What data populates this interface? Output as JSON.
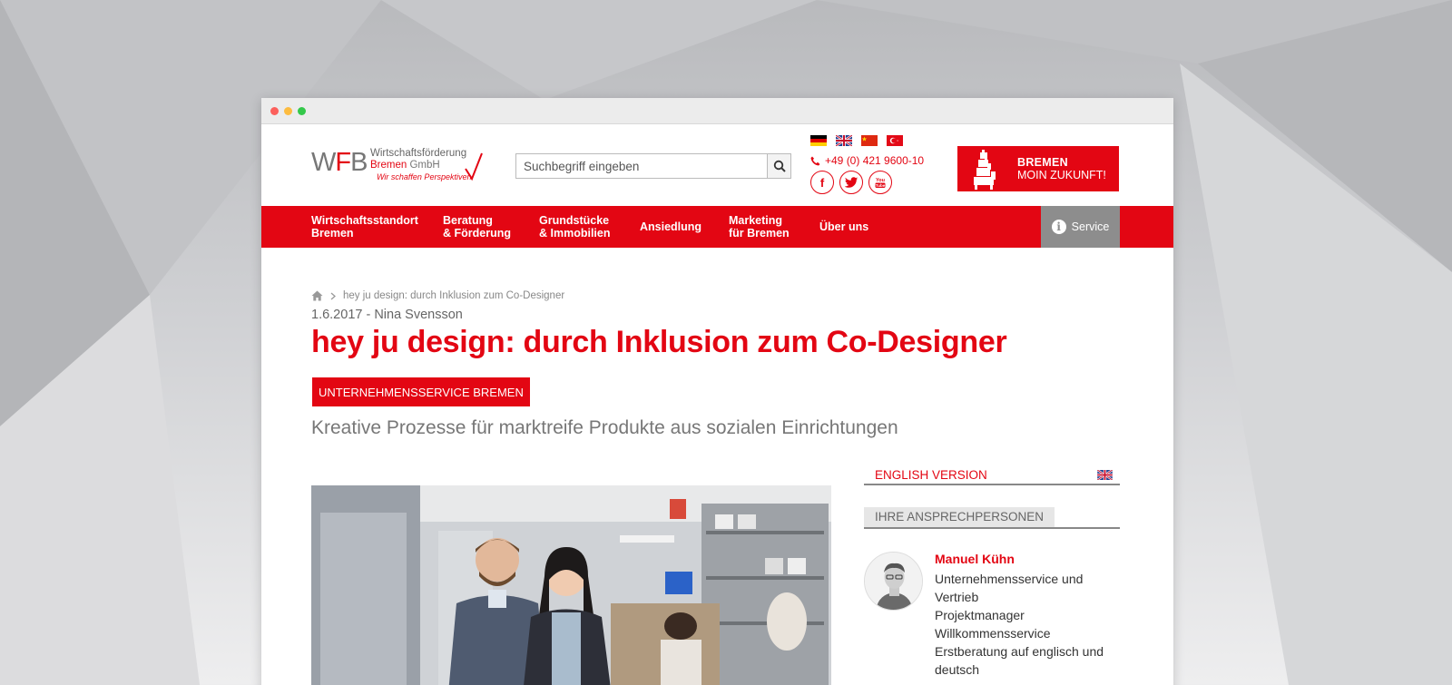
{
  "logo": {
    "wfb_w": "W",
    "wfb_f": "F",
    "wfb_b": "B",
    "line1": "Wirtschaftsförderung",
    "line2_red": "Bremen",
    "line2_grey": "GmbH",
    "tagline": "Wir schaffen Perspektiven"
  },
  "search": {
    "placeholder": "Suchbegriff eingeben",
    "icon": "search-icon"
  },
  "languages": [
    "de",
    "en",
    "zh",
    "tr"
  ],
  "contact": {
    "phone": "+49 (0) 421 9600-10"
  },
  "social": {
    "facebook": "f",
    "youtube": "You Tube"
  },
  "brand": {
    "line1": "BREMEN",
    "line2": "MOIN ZUKUNFT!"
  },
  "nav": {
    "items": [
      {
        "line1": "Wirtschaftsstandort",
        "line2": "Bremen"
      },
      {
        "line1": "Beratung",
        "line2": "& Förderung"
      },
      {
        "line1": "Grundstücke",
        "line2": "& Immobilien"
      },
      {
        "line1": "Ansiedlung",
        "line2": ""
      },
      {
        "line1": "Marketing",
        "line2": "für Bremen"
      },
      {
        "line1": "Über uns",
        "line2": ""
      }
    ],
    "service_label": "Service"
  },
  "article": {
    "breadcrumb_current": "hey ju design: durch Inklusion zum Co-Designer",
    "meta": "1.6.2017 - Nina Svensson",
    "headline": "hey ju design: durch Inklusion zum Co-Designer",
    "category": "UNTERNEHMENSSERVICE BREMEN",
    "subtitle": "Kreative Prozesse für marktreife Produkte aus sozialen Einrichtungen"
  },
  "sidebar": {
    "english_version": "ENGLISH VERSION",
    "contacts_heading": "IHRE ANSPRECHPERSONEN",
    "person": {
      "name": "Manuel Kühn",
      "roles": [
        "Unternehmensservice und Vertrieb",
        "Projektmanager Willkommensservice",
        "Erstberatung auf englisch und deutsch"
      ]
    }
  },
  "colors": {
    "brand_red": "#e30613",
    "service_grey": "#8d8d8d"
  }
}
